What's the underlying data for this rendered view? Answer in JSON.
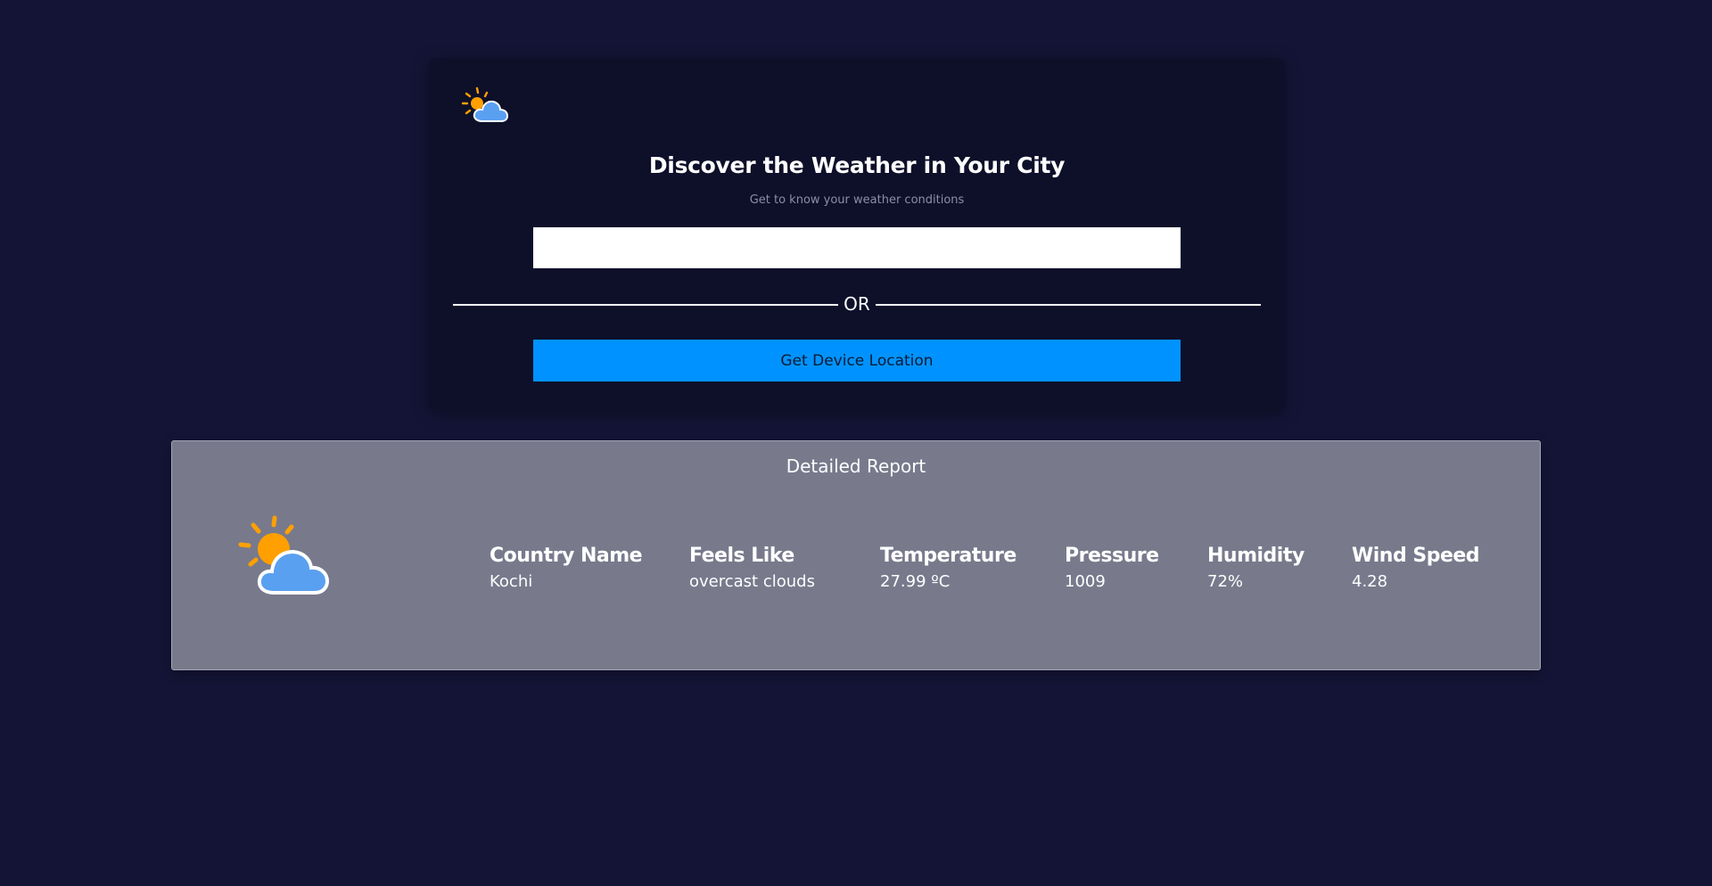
{
  "search_card": {
    "logo_icon": "sun-behind-cloud-icon",
    "title": "Discover the Weather in Your City",
    "subtitle": "Get to know your weather conditions",
    "city_input": {
      "value": "",
      "placeholder": ""
    },
    "divider_text": "OR",
    "location_button_label": "Get Device Location"
  },
  "report": {
    "title": "Detailed Report",
    "weather_icon": "partly-cloudy-icon",
    "stats": [
      {
        "label": "Country Name",
        "value": "Kochi"
      },
      {
        "label": "Feels Like",
        "value": "overcast clouds"
      },
      {
        "label": "Temperature",
        "value": "27.99 ºC"
      },
      {
        "label": "Pressure",
        "value": "1009"
      },
      {
        "label": "Humidity",
        "value": "72%"
      },
      {
        "label": "Wind Speed",
        "value": "4.28"
      }
    ]
  },
  "colors": {
    "page_background": "#141436",
    "card_background": "#0e102a",
    "button_blue": "#0093ff",
    "report_background": "#787a8c",
    "sun_orange": "#ffa000",
    "cloud_blue": "#5aa0f0"
  }
}
